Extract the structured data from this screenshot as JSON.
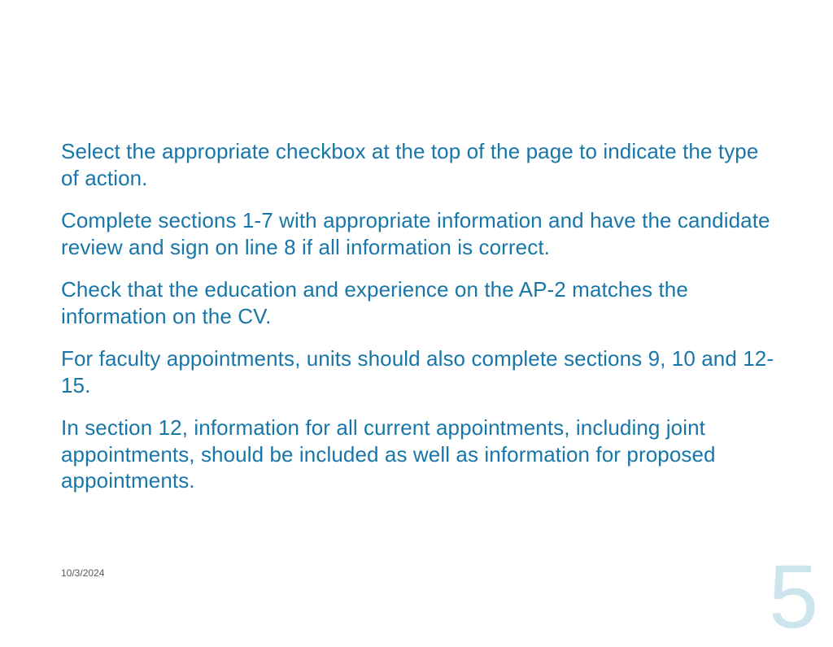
{
  "paragraphs": {
    "p1": "Select the appropriate checkbox at the top of the page to indicate the type of action.",
    "p2": "Complete sections 1-7 with appropriate information and have the candidate review and sign on line 8 if all information is correct.",
    "p3": "Check that the education and experience on the AP-2 matches the information on the CV.",
    "p4": "For faculty appointments, units should also complete sections 9, 10 and 12-15.",
    "p5": "In section 12, information for all current appointments, including joint appointments, should be included as well as information for proposed appointments."
  },
  "footer": {
    "date": "10/3/2024",
    "page_number": "5"
  }
}
